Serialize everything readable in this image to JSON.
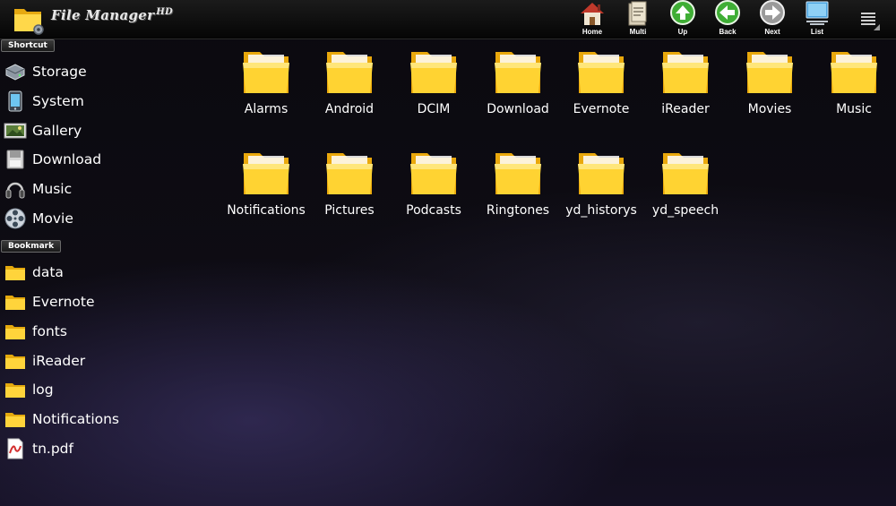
{
  "app": {
    "title": "File Manager",
    "title_suffix": "HD"
  },
  "toolbar": {
    "buttons": [
      {
        "label": "Home",
        "icon": "home-icon"
      },
      {
        "label": "Multi",
        "icon": "multi-select-icon"
      },
      {
        "label": "Up",
        "icon": "arrow-up-icon"
      },
      {
        "label": "Back",
        "icon": "arrow-left-icon"
      },
      {
        "label": "Next",
        "icon": "arrow-right-icon"
      },
      {
        "label": "List",
        "icon": "list-view-icon"
      }
    ],
    "menu_icon": "overflow-menu-icon"
  },
  "sidebar": {
    "shortcut_header": "Shortcut",
    "shortcuts": [
      {
        "label": "Storage",
        "icon": "storage-icon"
      },
      {
        "label": "System",
        "icon": "system-icon"
      },
      {
        "label": "Gallery",
        "icon": "gallery-icon"
      },
      {
        "label": "Download",
        "icon": "download-icon"
      },
      {
        "label": "Music",
        "icon": "music-icon"
      },
      {
        "label": "Movie",
        "icon": "movie-icon"
      }
    ],
    "bookmark_header": "Bookmark",
    "bookmarks": [
      {
        "label": "data",
        "icon": "folder-icon"
      },
      {
        "label": "Evernote",
        "icon": "folder-icon"
      },
      {
        "label": "fonts",
        "icon": "folder-icon"
      },
      {
        "label": "iReader",
        "icon": "folder-icon"
      },
      {
        "label": "log",
        "icon": "folder-icon"
      },
      {
        "label": "Notifications",
        "icon": "folder-icon"
      },
      {
        "label": "tn.pdf",
        "icon": "pdf-file-icon"
      }
    ]
  },
  "folders": [
    "Alarms",
    "Android",
    "DCIM",
    "Download",
    "Evernote",
    "iReader",
    "Movies",
    "Music",
    "Notifications",
    "Pictures",
    "Podcasts",
    "Ringtones",
    "yd_historys",
    "yd_speech"
  ],
  "colors": {
    "folder_yellow": "#f6c928",
    "button_green": "#3fae35",
    "button_gray": "#9a9a9a"
  }
}
